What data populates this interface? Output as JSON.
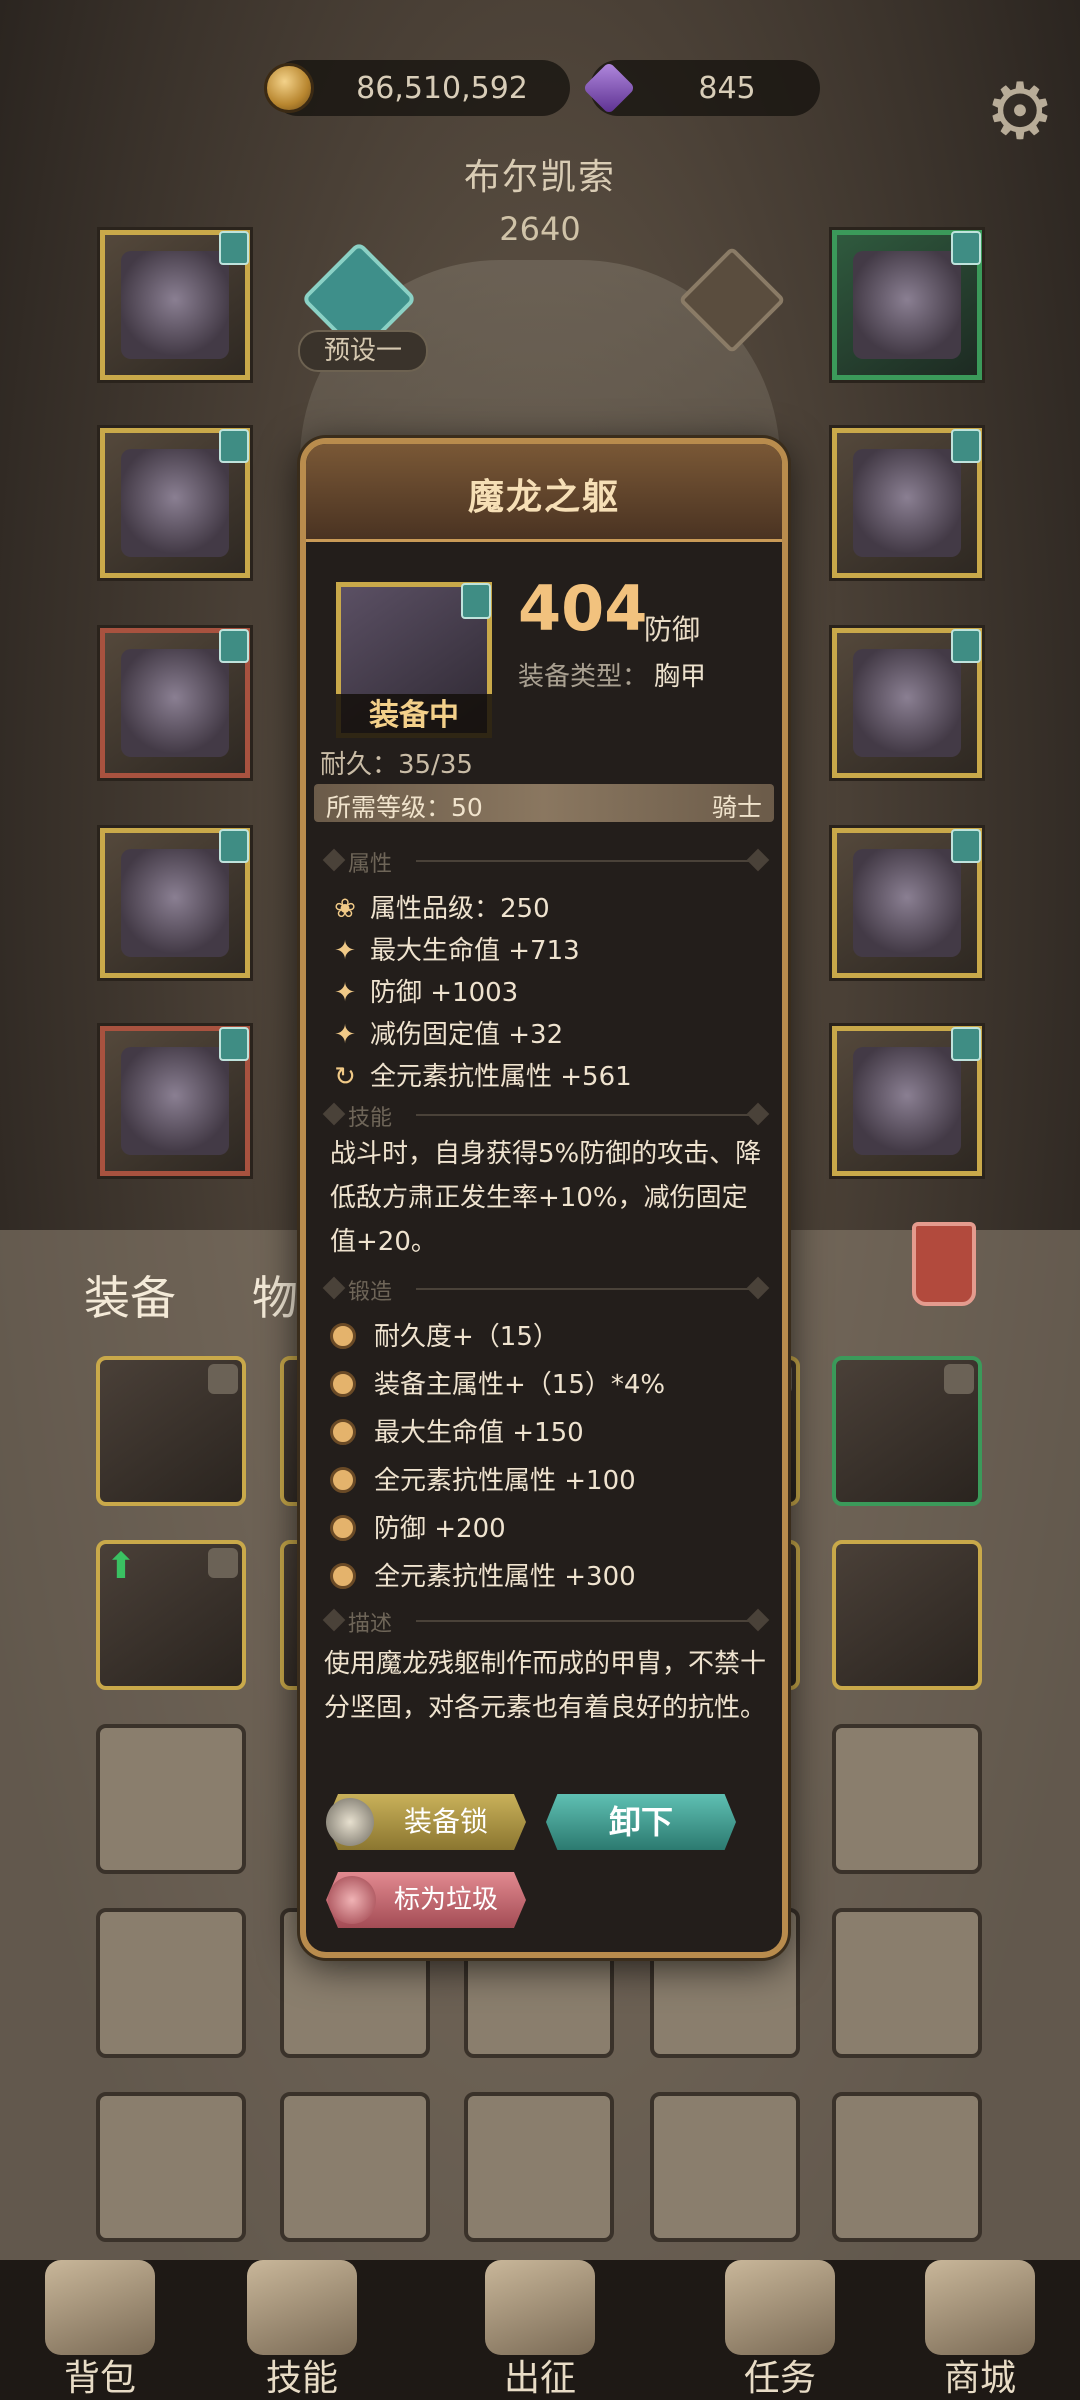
{
  "topbar": {
    "gold": "86,510,592",
    "gems": "845",
    "gold_icon": "coin-icon",
    "gem_icon": "purple-gem-icon",
    "settings_icon": "gear-icon"
  },
  "hero": {
    "name": "布尔凯索",
    "power": "2640",
    "preset_label": "预设一"
  },
  "bag": {
    "tab_equip": "装备",
    "tab_items": "物品"
  },
  "nav": [
    {
      "label": "背包",
      "icon": "backpack-icon"
    },
    {
      "label": "技能",
      "icon": "skill-book-icon"
    },
    {
      "label": "出征",
      "icon": "map-sword-icon"
    },
    {
      "label": "任务",
      "icon": "scroll-icon"
    },
    {
      "label": "商城",
      "icon": "shop-crown-icon"
    }
  ],
  "card": {
    "title": "魔龙之躯",
    "equipped_label": "装备中",
    "defense_value": "404",
    "defense_unit": "防御",
    "equip_type_label": "装备类型：",
    "equip_type_value": "胸甲",
    "durability": "耐久：35/35",
    "required_level": "所需等级：50",
    "class": "骑士",
    "section_attr": "属性",
    "section_skill": "技能",
    "section_forge": "锻造",
    "section_desc": "描述",
    "attributes": [
      "属性品级：250",
      "最大生命值 +713",
      "防御 +1003",
      "减伤固定值 +32",
      "全元素抗性属性 +561"
    ],
    "skill_text": "战斗时，自身获得5%防御的攻击、降低敌方肃正发生率+10%，减伤固定值+20。",
    "forge": [
      "耐久度+（15）",
      "装备主属性+（15）*4%",
      "最大生命值 +150",
      "全元素抗性属性 +100",
      "防御 +200",
      "全元素抗性属性 +300"
    ],
    "description": "使用魔龙残躯制作而成的甲胄，不禁十分坚固，对各元素也有着良好的抗性。",
    "btn_lock": "装备锁",
    "btn_unequip": "卸下",
    "btn_junk": "标为垃圾"
  },
  "colors": {
    "gold_border": "#c9a94a",
    "green_border": "#3b9a5a",
    "accent": "#f2c27e",
    "unequip_btn": "#3fa095"
  }
}
